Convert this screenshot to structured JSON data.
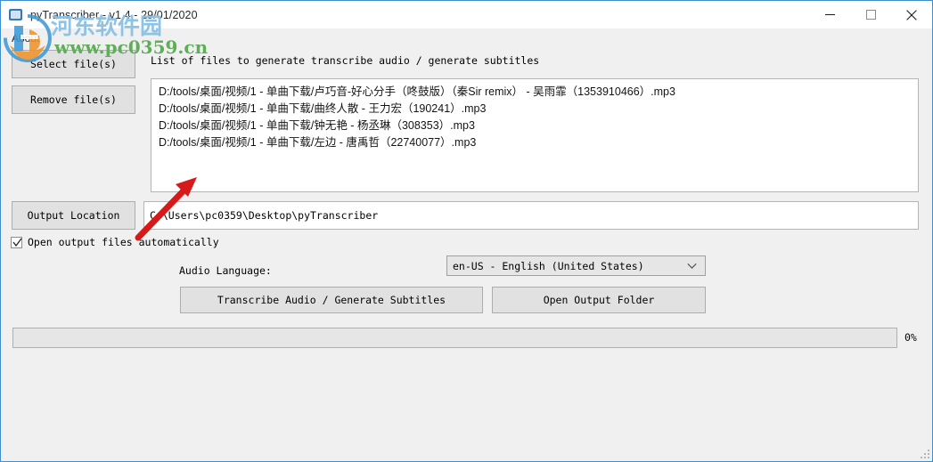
{
  "window": {
    "title": "pyTranscriber - v1.4 - 29/01/2020",
    "app_icon": "app-icon",
    "controls": {
      "minimize": "minimize-icon",
      "maximize": "maximize-icon",
      "close": "close-icon"
    },
    "border_color": "#3f8fce",
    "background_color": "#f0f0f0"
  },
  "menubar": {
    "items": [
      {
        "label": "About"
      }
    ]
  },
  "buttons": {
    "select_files": "Select file(s)",
    "remove_files": "Remove file(s)",
    "output_location": "Output Location",
    "transcribe": "Transcribe Audio / Generate Subtitles",
    "open_output_folder": "Open Output Folder"
  },
  "file_list": {
    "caption": "List of files to generate transcribe audio / generate subtitles",
    "items": [
      "D:/tools/桌面/视频/1 - 单曲下载/卢巧音-好心分手（咚鼓版）（秦Sir remix） - 吴雨霏（1353910466）.mp3",
      "D:/tools/桌面/视频/1 - 单曲下载/曲终人散 - 王力宏（190241）.mp3",
      "D:/tools/桌面/视频/1 - 单曲下载/钟无艳 - 杨丞琳（308353）.mp3",
      "D:/tools/桌面/视频/1 - 单曲下载/左边 - 唐禹哲（22740077）.mp3"
    ]
  },
  "output": {
    "path_value": "C:\\Users\\pc0359\\Desktop\\pyTranscriber",
    "path_placeholder": "",
    "open_automatically_label": "Open output files automatically",
    "open_automatically_checked": true
  },
  "language": {
    "label": "Audio Language:",
    "selected": "en-US - English (United States)",
    "dropdown_icon": "chevron-down-icon"
  },
  "progress": {
    "percent_label": "0%",
    "percent_value": 0
  },
  "watermark": {
    "site_name_cn": "河东软件园",
    "site_url": "www.pc0359.cn",
    "cn_color": "#8ec3e8",
    "url_color": "#5fae5a",
    "logo_blue": "#3f9ad6",
    "logo_orange": "#f0932b"
  },
  "annotation": {
    "arrow_color": "#d61a1a",
    "arrow_name": "red-pointer-arrow"
  }
}
